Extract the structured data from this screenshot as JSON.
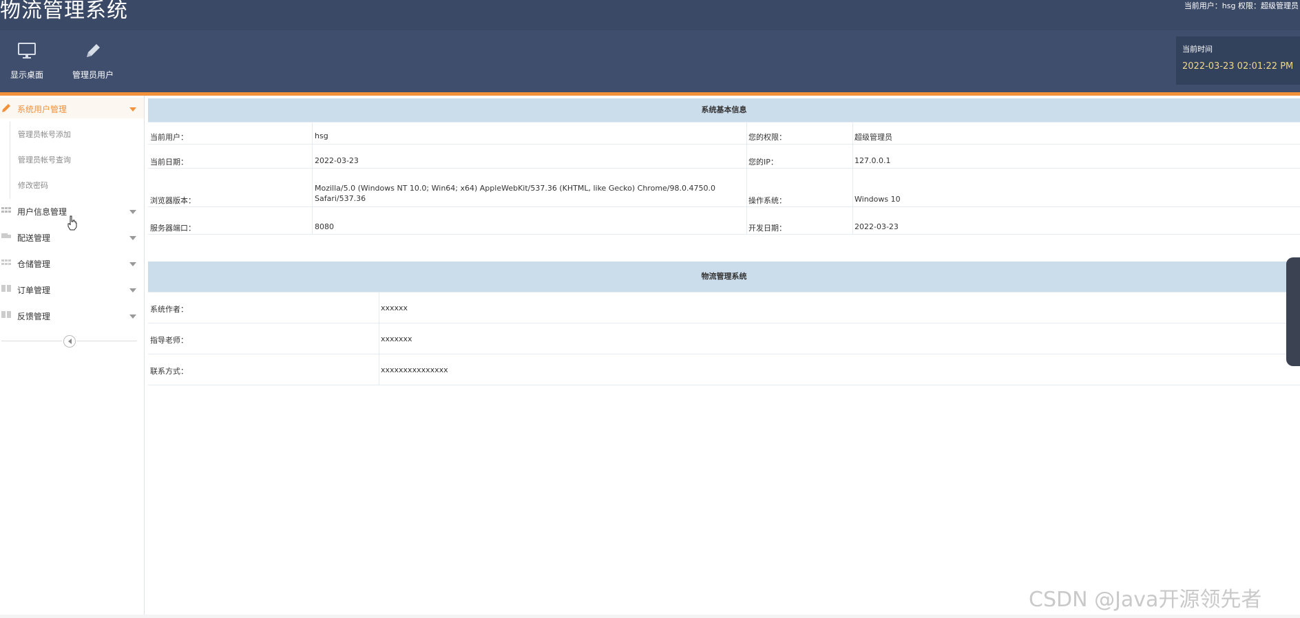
{
  "header": {
    "title": "物流管理系统",
    "user_info": "当前用户：hsg 权限：超级管理员",
    "toolbar": [
      {
        "label": "显示桌面",
        "icon": "monitor-icon"
      },
      {
        "label": "管理员用户",
        "icon": "pencil-icon"
      }
    ],
    "time_label": "当前时间",
    "time_value": "2022-03-23 02:01:22 PM"
  },
  "colors": {
    "header_bg": "#3e4e6c",
    "accent": "#f3913b",
    "table_header": "#cbdcea",
    "time_text": "#f0d68a"
  },
  "sidebar": {
    "menus": [
      {
        "label": "系统用户管理",
        "icon": "pencil-icon",
        "active": true
      },
      {
        "label": "用户信息管理",
        "icon": "grid-icon"
      },
      {
        "label": "配送管理",
        "icon": "truck-icon"
      },
      {
        "label": "仓储管理",
        "icon": "grid-icon"
      },
      {
        "label": "订单管理",
        "icon": "grid-icon"
      },
      {
        "label": "反馈管理",
        "icon": "grid-icon"
      }
    ],
    "submenu": [
      "管理员帐号添加",
      "管理员帐号查询",
      "修改密码"
    ]
  },
  "sysinfo": {
    "title": "系统基本信息",
    "rows": [
      {
        "l1": "当前用户：",
        "v1": "hsg",
        "l2": "您的权限：",
        "v2": "超级管理员"
      },
      {
        "l1": "当前日期：",
        "v1": "2022-03-23",
        "l2": "您的IP：",
        "v2": "127.0.0.1"
      },
      {
        "l1": "浏览器版本：",
        "v1a": "Mozilla/5.0 (Windows NT 10.0; Win64; x64) AppleWebKit/537.36 (KHTML, like Gecko) Chrome/98.0.4750.0",
        "v1b": "Safari/537.36",
        "l2": "操作系统：",
        "v2": "Windows 10"
      },
      {
        "l1": "服务器端口：",
        "v1": "8080",
        "l2": "开发日期：",
        "v2": "2022-03-23"
      }
    ]
  },
  "about": {
    "title": "物流管理系统",
    "rows": [
      {
        "label": "系统作者：",
        "value": "xxxxxx"
      },
      {
        "label": "指导老师：",
        "value": "xxxxxxx"
      },
      {
        "label": "联系方式：",
        "value": "xxxxxxxxxxxxxxx"
      }
    ]
  },
  "watermark": "CSDN @Java开源领先者"
}
